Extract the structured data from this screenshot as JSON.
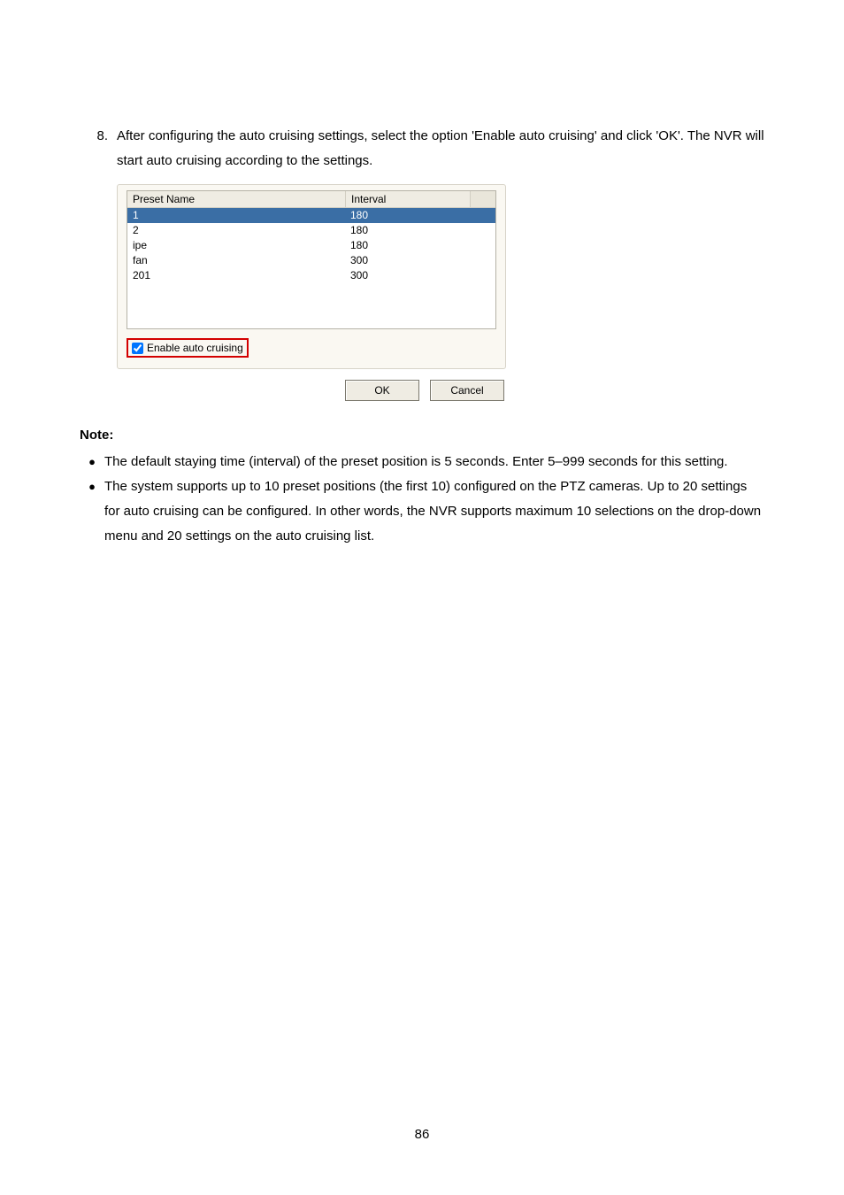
{
  "step": {
    "number": "8.",
    "text": "After configuring the auto cruising settings, select the option 'Enable auto cruising' and click 'OK'.   The NVR will start auto cruising according to the settings."
  },
  "dialog": {
    "headers": {
      "name": "Preset Name",
      "interval": "Interval"
    },
    "rows": [
      {
        "name": "1",
        "interval": "180",
        "selected": true
      },
      {
        "name": "2",
        "interval": "180",
        "selected": false
      },
      {
        "name": "ipe",
        "interval": "180",
        "selected": false
      },
      {
        "name": "fan",
        "interval": "300",
        "selected": false
      },
      {
        "name": "201",
        "interval": "300",
        "selected": false
      }
    ],
    "checkbox_label": "Enable auto cruising",
    "ok_label": "OK",
    "cancel_label": "Cancel"
  },
  "note": {
    "heading": "Note:",
    "bullets": [
      "The default staying time (interval) of the preset position is 5 seconds.   Enter 5–999 seconds for this setting.",
      "The system supports up to 10 preset positions (the first 10) configured on the PTZ cameras.   Up to 20 settings for auto cruising can be configured.   In other words, the NVR supports maximum 10 selections on the drop-down menu and 20 settings on the auto cruising list."
    ]
  },
  "page_number": "86"
}
